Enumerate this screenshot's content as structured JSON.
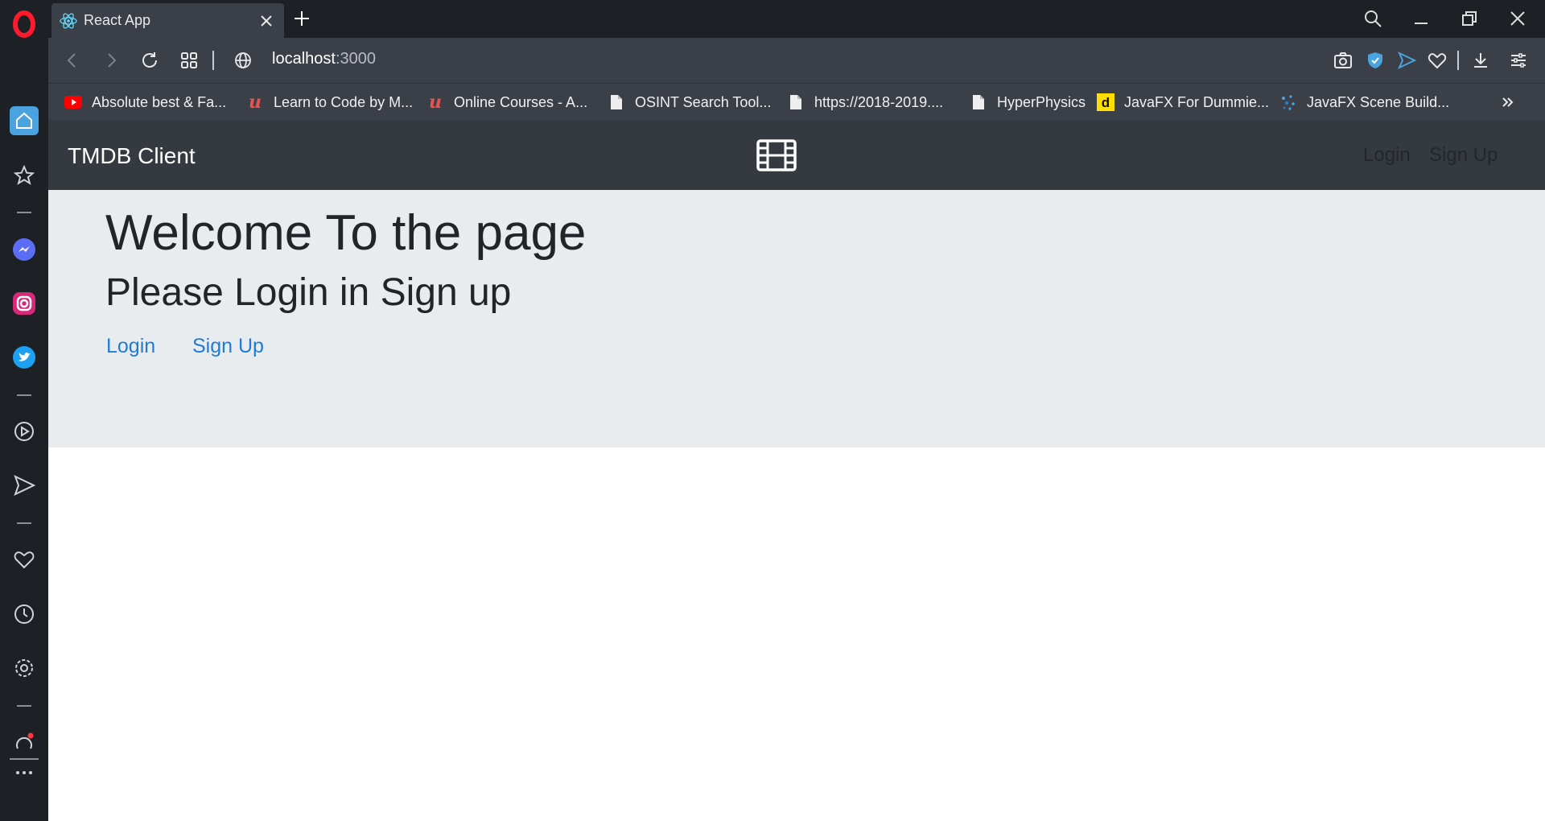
{
  "browser": {
    "tab_title": "React App",
    "url_host": "localhost",
    "url_port": ":3000"
  },
  "bookmarks": [
    {
      "label": "Absolute best & Fa...",
      "icon": "youtube-icon"
    },
    {
      "label": "Learn to Code by M...",
      "icon": "udemy-icon"
    },
    {
      "label": "Online Courses - A...",
      "icon": "udemy-icon"
    },
    {
      "label": "OSINT Search Tool...",
      "icon": "document-icon"
    },
    {
      "label": "https://2018-2019....",
      "icon": "document-icon"
    },
    {
      "label": "HyperPhysics",
      "icon": "document-icon"
    },
    {
      "label": "JavaFX For Dummie...",
      "icon": "dummies-icon"
    },
    {
      "label": "JavaFX Scene Build...",
      "icon": "scene-builder-icon"
    }
  ],
  "navbar": {
    "brand": "TMDB Client",
    "login": "Login",
    "signup": "Sign Up"
  },
  "main": {
    "heading": "Welcome To the page",
    "subheading": "Please Login in Sign up",
    "login_link": "Login",
    "signup_link": "Sign Up"
  },
  "colors": {
    "navbar_bg": "#343a40",
    "jumbotron_bg": "#e9ecef",
    "link": "#1e7cd6"
  }
}
